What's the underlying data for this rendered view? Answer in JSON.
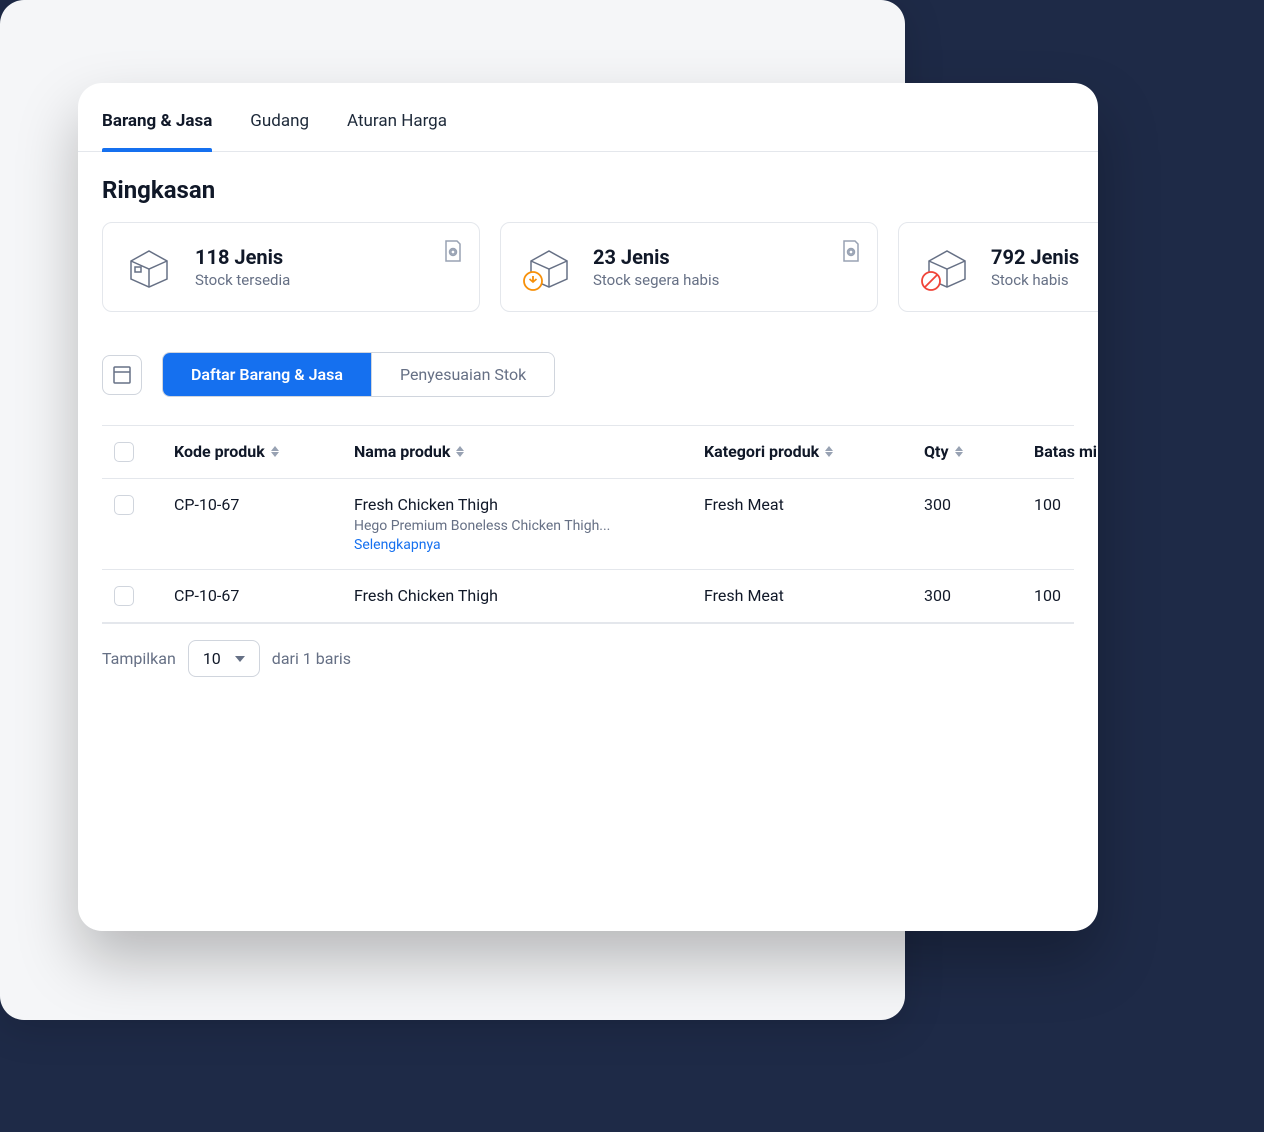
{
  "tabs": [
    {
      "label": "Barang & Jasa",
      "active": true
    },
    {
      "label": "Gudang",
      "active": false
    },
    {
      "label": "Aturan Harga",
      "active": false
    }
  ],
  "section_title": "Ringkasan",
  "summary_cards": [
    {
      "title": "118 Jenis",
      "sub": "Stock tersedia"
    },
    {
      "title": "23 Jenis",
      "sub": "Stock segera habis"
    },
    {
      "title": "792 Jenis",
      "sub": "Stock habis"
    }
  ],
  "subtabs": [
    {
      "label": "Daftar Barang & Jasa",
      "active": true
    },
    {
      "label": "Penyesuaian Stok",
      "active": false
    }
  ],
  "table": {
    "headers": {
      "code": "Kode produk",
      "name": "Nama produk",
      "category": "Kategori produk",
      "qty": "Qty",
      "min_limit": "Batas mi"
    },
    "rows": [
      {
        "code": "CP-10-67",
        "name": "Fresh Chicken Thigh",
        "desc": "Hego Premium Boneless Chicken Thigh...",
        "more": "Selengkapnya",
        "category": "Fresh Meat",
        "qty": "300",
        "min_limit": "100"
      },
      {
        "code": "CP-10-67",
        "name": "Fresh Chicken Thigh",
        "desc": "",
        "more": "",
        "category": "Fresh Meat",
        "qty": "300",
        "min_limit": "100"
      }
    ]
  },
  "pagination": {
    "show_label": "Tampilkan",
    "per_page": "10",
    "of_label": "dari 1 baris"
  }
}
